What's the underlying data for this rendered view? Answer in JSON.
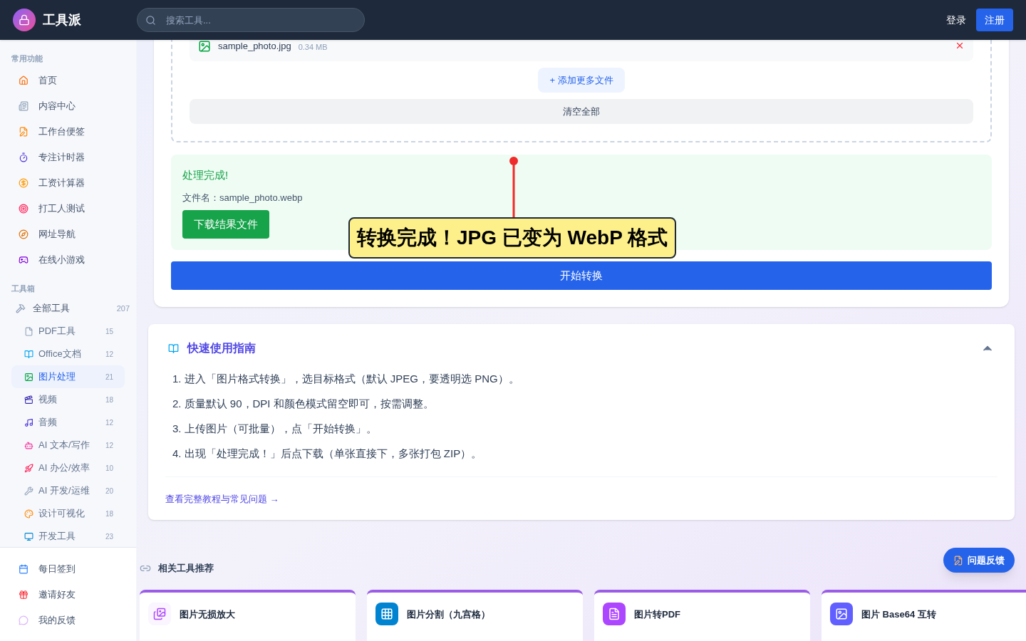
{
  "header": {
    "brand": "工具派",
    "search_placeholder": "搜索工具...",
    "login": "登录",
    "register": "注册"
  },
  "sidebar": {
    "common_title": "常用功能",
    "common": [
      {
        "label": "首页",
        "kind": "home"
      },
      {
        "label": "内容中心",
        "kind": "news"
      },
      {
        "label": "工作台便签",
        "kind": "note"
      },
      {
        "label": "专注计时器",
        "kind": "timer"
      },
      {
        "label": "工资计算器",
        "kind": "money"
      },
      {
        "label": "打工人测试",
        "kind": "target"
      },
      {
        "label": "网址导航",
        "kind": "compass"
      },
      {
        "label": "在线小游戏",
        "kind": "game"
      }
    ],
    "toolbox_title": "工具箱",
    "all_tools": {
      "label": "全部工具",
      "count": "207"
    },
    "categories": [
      {
        "label": "PDF工具",
        "count": "15",
        "kind": "file",
        "selected": false
      },
      {
        "label": "Office文档",
        "count": "12",
        "kind": "book",
        "selected": false
      },
      {
        "label": "图片处理",
        "count": "21",
        "kind": "image",
        "selected": true
      },
      {
        "label": "视频",
        "count": "18",
        "kind": "video",
        "selected": false
      },
      {
        "label": "音频",
        "count": "12",
        "kind": "music",
        "selected": false
      },
      {
        "label": "AI 文本/写作",
        "count": "12",
        "kind": "bot",
        "selected": false
      },
      {
        "label": "AI 办公/效率",
        "count": "10",
        "kind": "rocket",
        "selected": false
      },
      {
        "label": "AI 开发/运维",
        "count": "20",
        "kind": "wrench",
        "selected": false
      },
      {
        "label": "设计可视化",
        "count": "18",
        "kind": "palette",
        "selected": false
      },
      {
        "label": "开发工具",
        "count": "23",
        "kind": "monitor",
        "selected": false
      }
    ],
    "bottom": [
      {
        "label": "每日签到",
        "kind": "calendar"
      },
      {
        "label": "邀请好友",
        "kind": "gift"
      },
      {
        "label": "我的反馈",
        "kind": "chat"
      }
    ]
  },
  "upload": {
    "file": {
      "name": "sample_photo.jpg",
      "size": "0.34 MB"
    },
    "add_more": "+ 添加更多文件",
    "clear_all": "清空全部"
  },
  "result": {
    "title": "处理完成!",
    "filename": "文件名：sample_photo.webp",
    "download": "下载结果文件"
  },
  "annotation": "转换完成！JPG 已变为 WebP 格式",
  "start_button": "开始转换",
  "guide": {
    "title": "快速使用指南",
    "expanded": true,
    "steps": [
      "1. 进入「图片格式转换」，选目标格式（默认 JPEG，要透明选 PNG）。",
      "2. 质量默认 90，DPI 和颜色模式留空即可，按需调整。",
      "3. 上传图片（可批量），点「开始转换」。",
      "4. 出现「处理完成！」后点下载（单张直接下，多张打包 ZIP）。"
    ],
    "link": "查看完整教程与常见问题 →"
  },
  "feedback_button": "问题反馈",
  "related": {
    "title": "相关工具推荐",
    "tools": [
      {
        "name": "图片无损放大",
        "kind": "upscale"
      },
      {
        "name": "图片分割（九宫格）",
        "kind": "grid"
      },
      {
        "name": "图片转PDF",
        "kind": "topdf"
      },
      {
        "name": "图片 Base64 互转",
        "kind": "base64"
      }
    ]
  }
}
